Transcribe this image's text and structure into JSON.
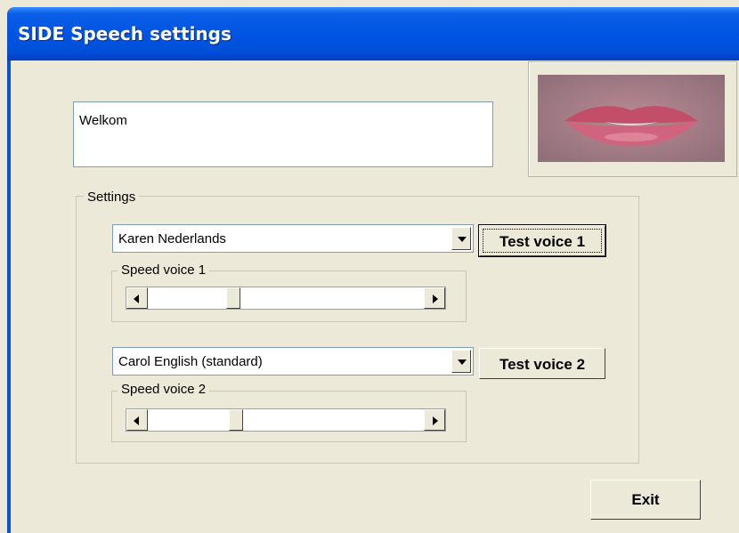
{
  "window": {
    "title": "SIDE Speech settings"
  },
  "text_input": {
    "value": "Welkom"
  },
  "lips_image": {
    "icon": "lips-image"
  },
  "settings": {
    "group_label": "Settings",
    "voice1": {
      "selected": "Karen Nederlands",
      "test_button": "Test voice 1",
      "speed_label": "Speed voice 1",
      "speed_level_fraction": 0.3
    },
    "voice2": {
      "selected": "Carol English (standard)",
      "test_button": "Test voice 2",
      "speed_label": "Speed voice 2",
      "speed_level_fraction": 0.31
    }
  },
  "exit_button": "Exit",
  "colors": {
    "titlebar": "#0054e3",
    "window_bg": "#ece9d8",
    "input_border": "#7f9db9"
  }
}
